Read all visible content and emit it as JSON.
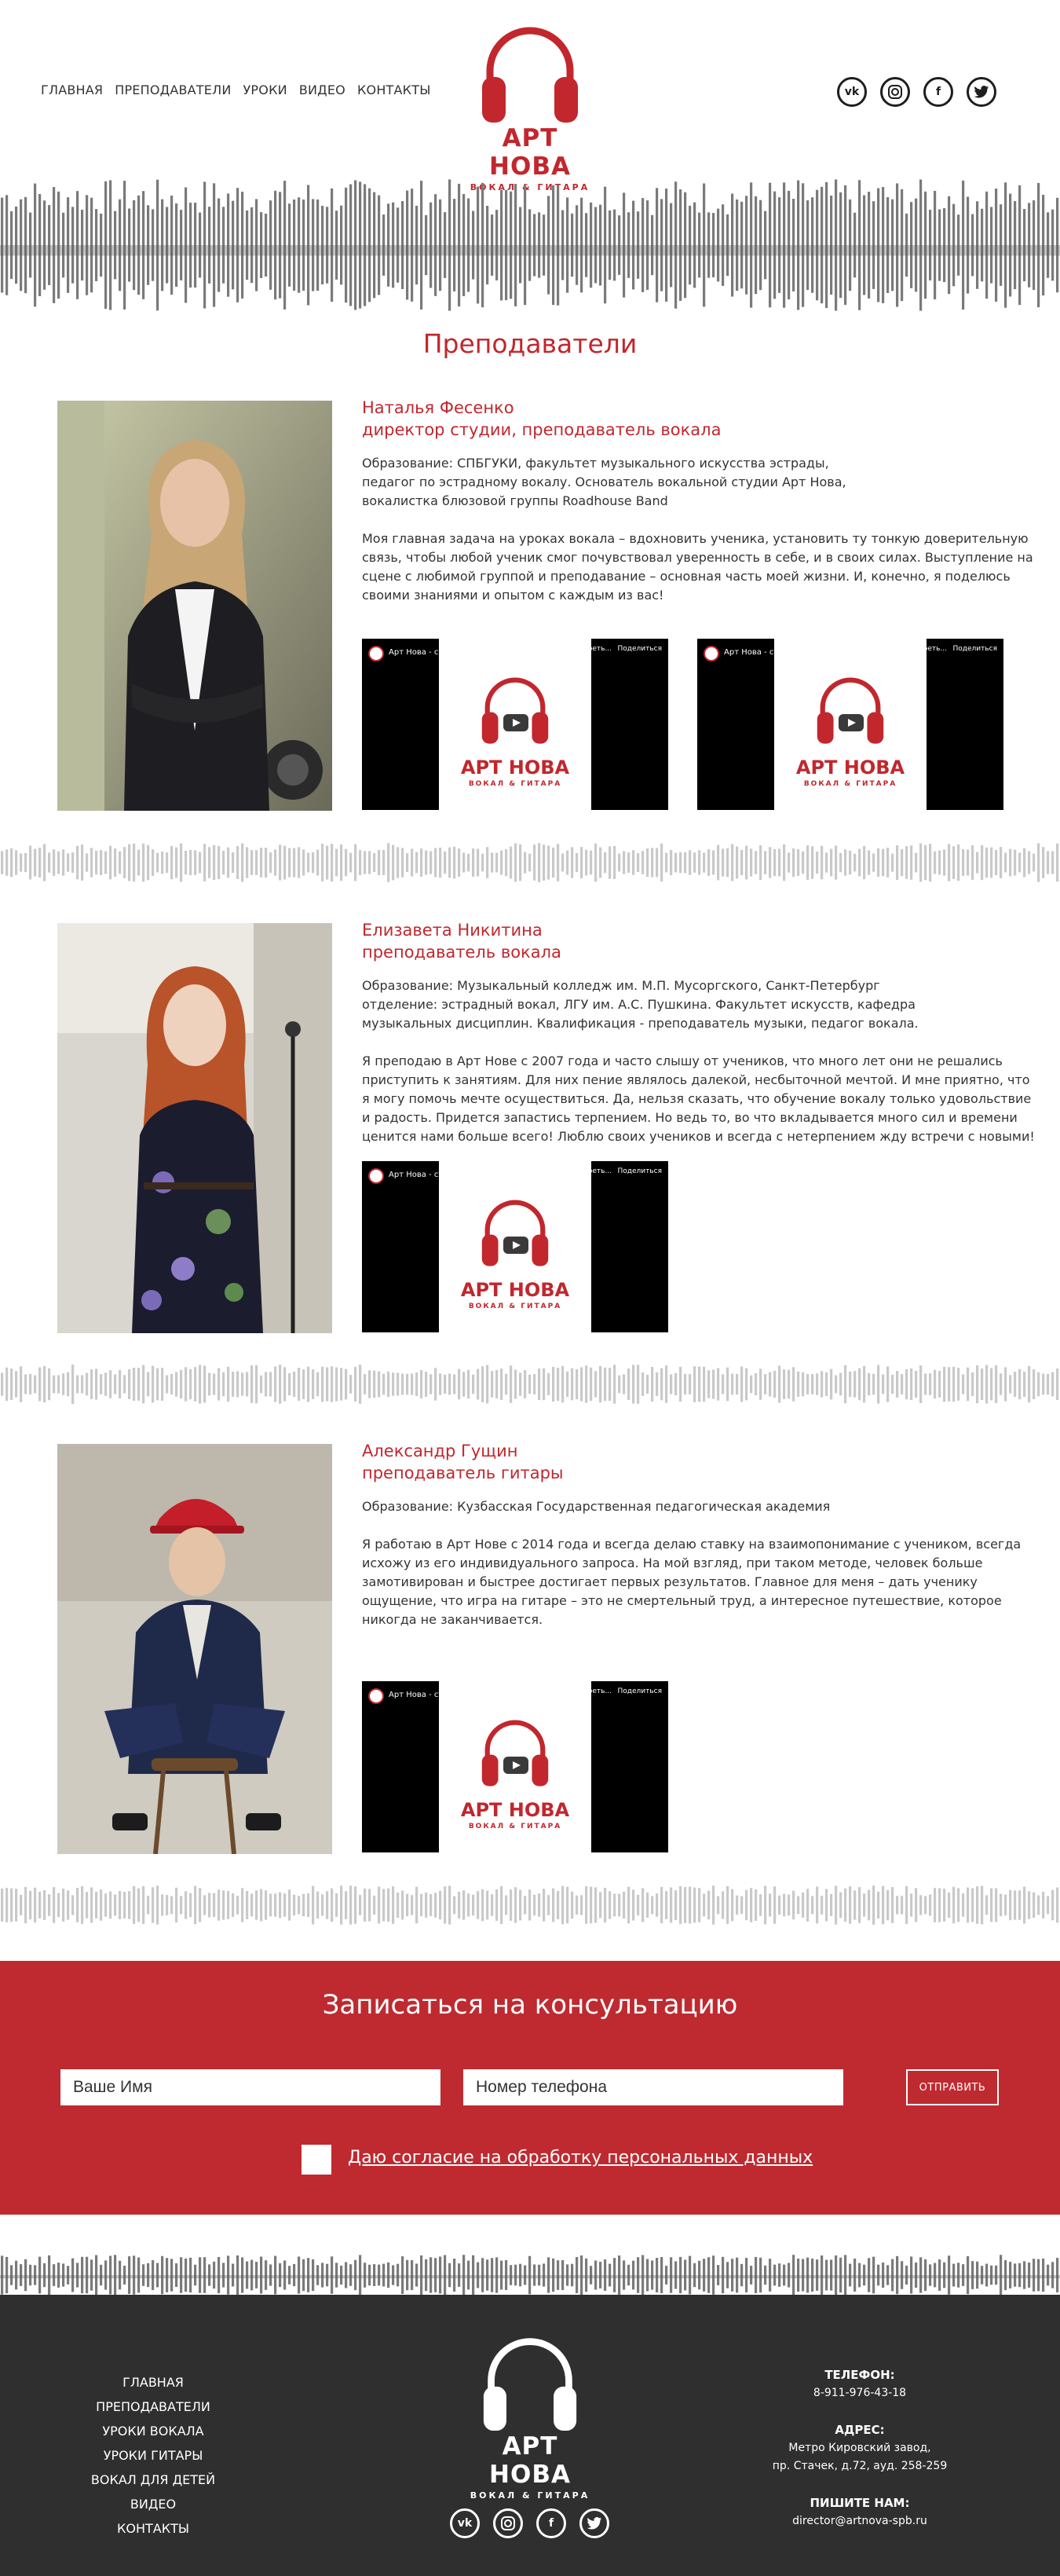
{
  "nav": [
    "ГЛАВНАЯ",
    "ПРЕПОДАВАТЕЛИ",
    "УРОКИ",
    "ВИДЕО",
    "КОНТАКТЫ"
  ],
  "logo": {
    "brand": "АРТ НОВА",
    "sub": "ВОКАЛ & ГИТАРА"
  },
  "socials": [
    "vk-icon",
    "instagram-icon",
    "facebook-icon",
    "twitter-icon"
  ],
  "colors": {
    "accent": "#c1272d",
    "footer": "#2f2f2f",
    "wave": "#7a7a7a",
    "wave_light": "#c9c9c9"
  },
  "section_title": "Преподаватели",
  "teachers": [
    {
      "name": "Наталья Фесенко",
      "role": "директор студии, преподаватель вокала",
      "paragraphs": [
        "Образование: СПБГУКИ, факультет музыкального искусства эстрады, педагог по эстрадному вокалу. Основатель вокальной студии Арт Нова, вокалистка блюзовой группы Roadhouse Band",
        "Моя главная задача на уроках вокала – вдохновить ученика, установить ту тонкую доверительную связь, чтобы любой ученик смог почувствовал уверенность в себе, и в своих силах. Выступление на сцене с любимой группой и преподавание – основная часть моей жизни. И, конечно, я поделюсь своими знаниями и опытом с каждым из вас!"
      ]
    },
    {
      "name": "Елизавета Никитина",
      "role": "преподаватель вокала",
      "paragraphs": [
        "Образование: Музыкальный колледж им. М.П. Мусоргского, Санкт-Петербург отделение: эстрадный вокал, ЛГУ им. А.С. Пушкина. Факультет искусств, кафедра музыкальных дисциплин. Квалификация - преподаватель музыки, педагог вокала.",
        "Я преподаю в Арт Нове с 2007 года и часто слышу от учеников, что много лет они не решались приступить к занятиям. Для них пение являлось далекой, несбыточной мечтой. И мне приятно, что я могу помочь мечте осуществиться. Да, нельзя сказать, что обучение вокалу только удовольствие и радость. Придется запастись терпением. Но ведь то, во что вкладывается много сил и времени ценится нами больше всего! Люблю своих учеников и всегда с нетерпением жду встречи с новыми!"
      ]
    },
    {
      "name": "Александр Гущин",
      "role": "преподаватель гитары",
      "paragraphs": [
        "Образование: Кузбасская Государственная педагогическая академия",
        "Я работаю в Арт Нове с 2014 года и всегда делаю ставку на взаимопонимание с учеником, всегда исхожу из его индивидуального запроса. На мой взгляд, при таком методе, человек больше замотивирован и быстрее достигает первых результатов. Главное для меня – дать ученику ощущение, что игра на гитаре – это не смертельный труд, а интересное путешествие, которое никогда не заканчивается."
      ]
    }
  ],
  "video": {
    "title": "Арт Нова - студия вокала и гитары",
    "watch_later": "Смотреть...",
    "share": "Поделиться",
    "brand": "АРТ НОВА",
    "sub": "ВОКАЛ & ГИТАРА"
  },
  "form": {
    "title": "Записаться на консультацию",
    "name_placeholder": "Ваше Имя",
    "phone_placeholder": "Номер телефона",
    "submit": "ОТПРАВИТЬ",
    "consent": "Даю согласие на обработку персональных данных"
  },
  "footer": {
    "nav": [
      "ГЛАВНАЯ",
      "ПРЕПОДАВАТЕЛИ",
      "УРОКИ ВОКАЛА",
      "УРОКИ ГИТАРЫ",
      "ВОКАЛ ДЛЯ ДЕТЕЙ",
      "ВИДЕО",
      "КОНТАКТЫ"
    ],
    "phone_label": "ТЕЛЕФОН:",
    "phone": "8-911-976-43-18",
    "address_label": "АДРЕС:",
    "address_line1": "Метро Кировский завод,",
    "address_line2": "пр. Стачек, д.72, ауд. 258-259",
    "email_label": "ПИШИТЕ НАМ:",
    "email": "director@artnova-spb.ru"
  }
}
